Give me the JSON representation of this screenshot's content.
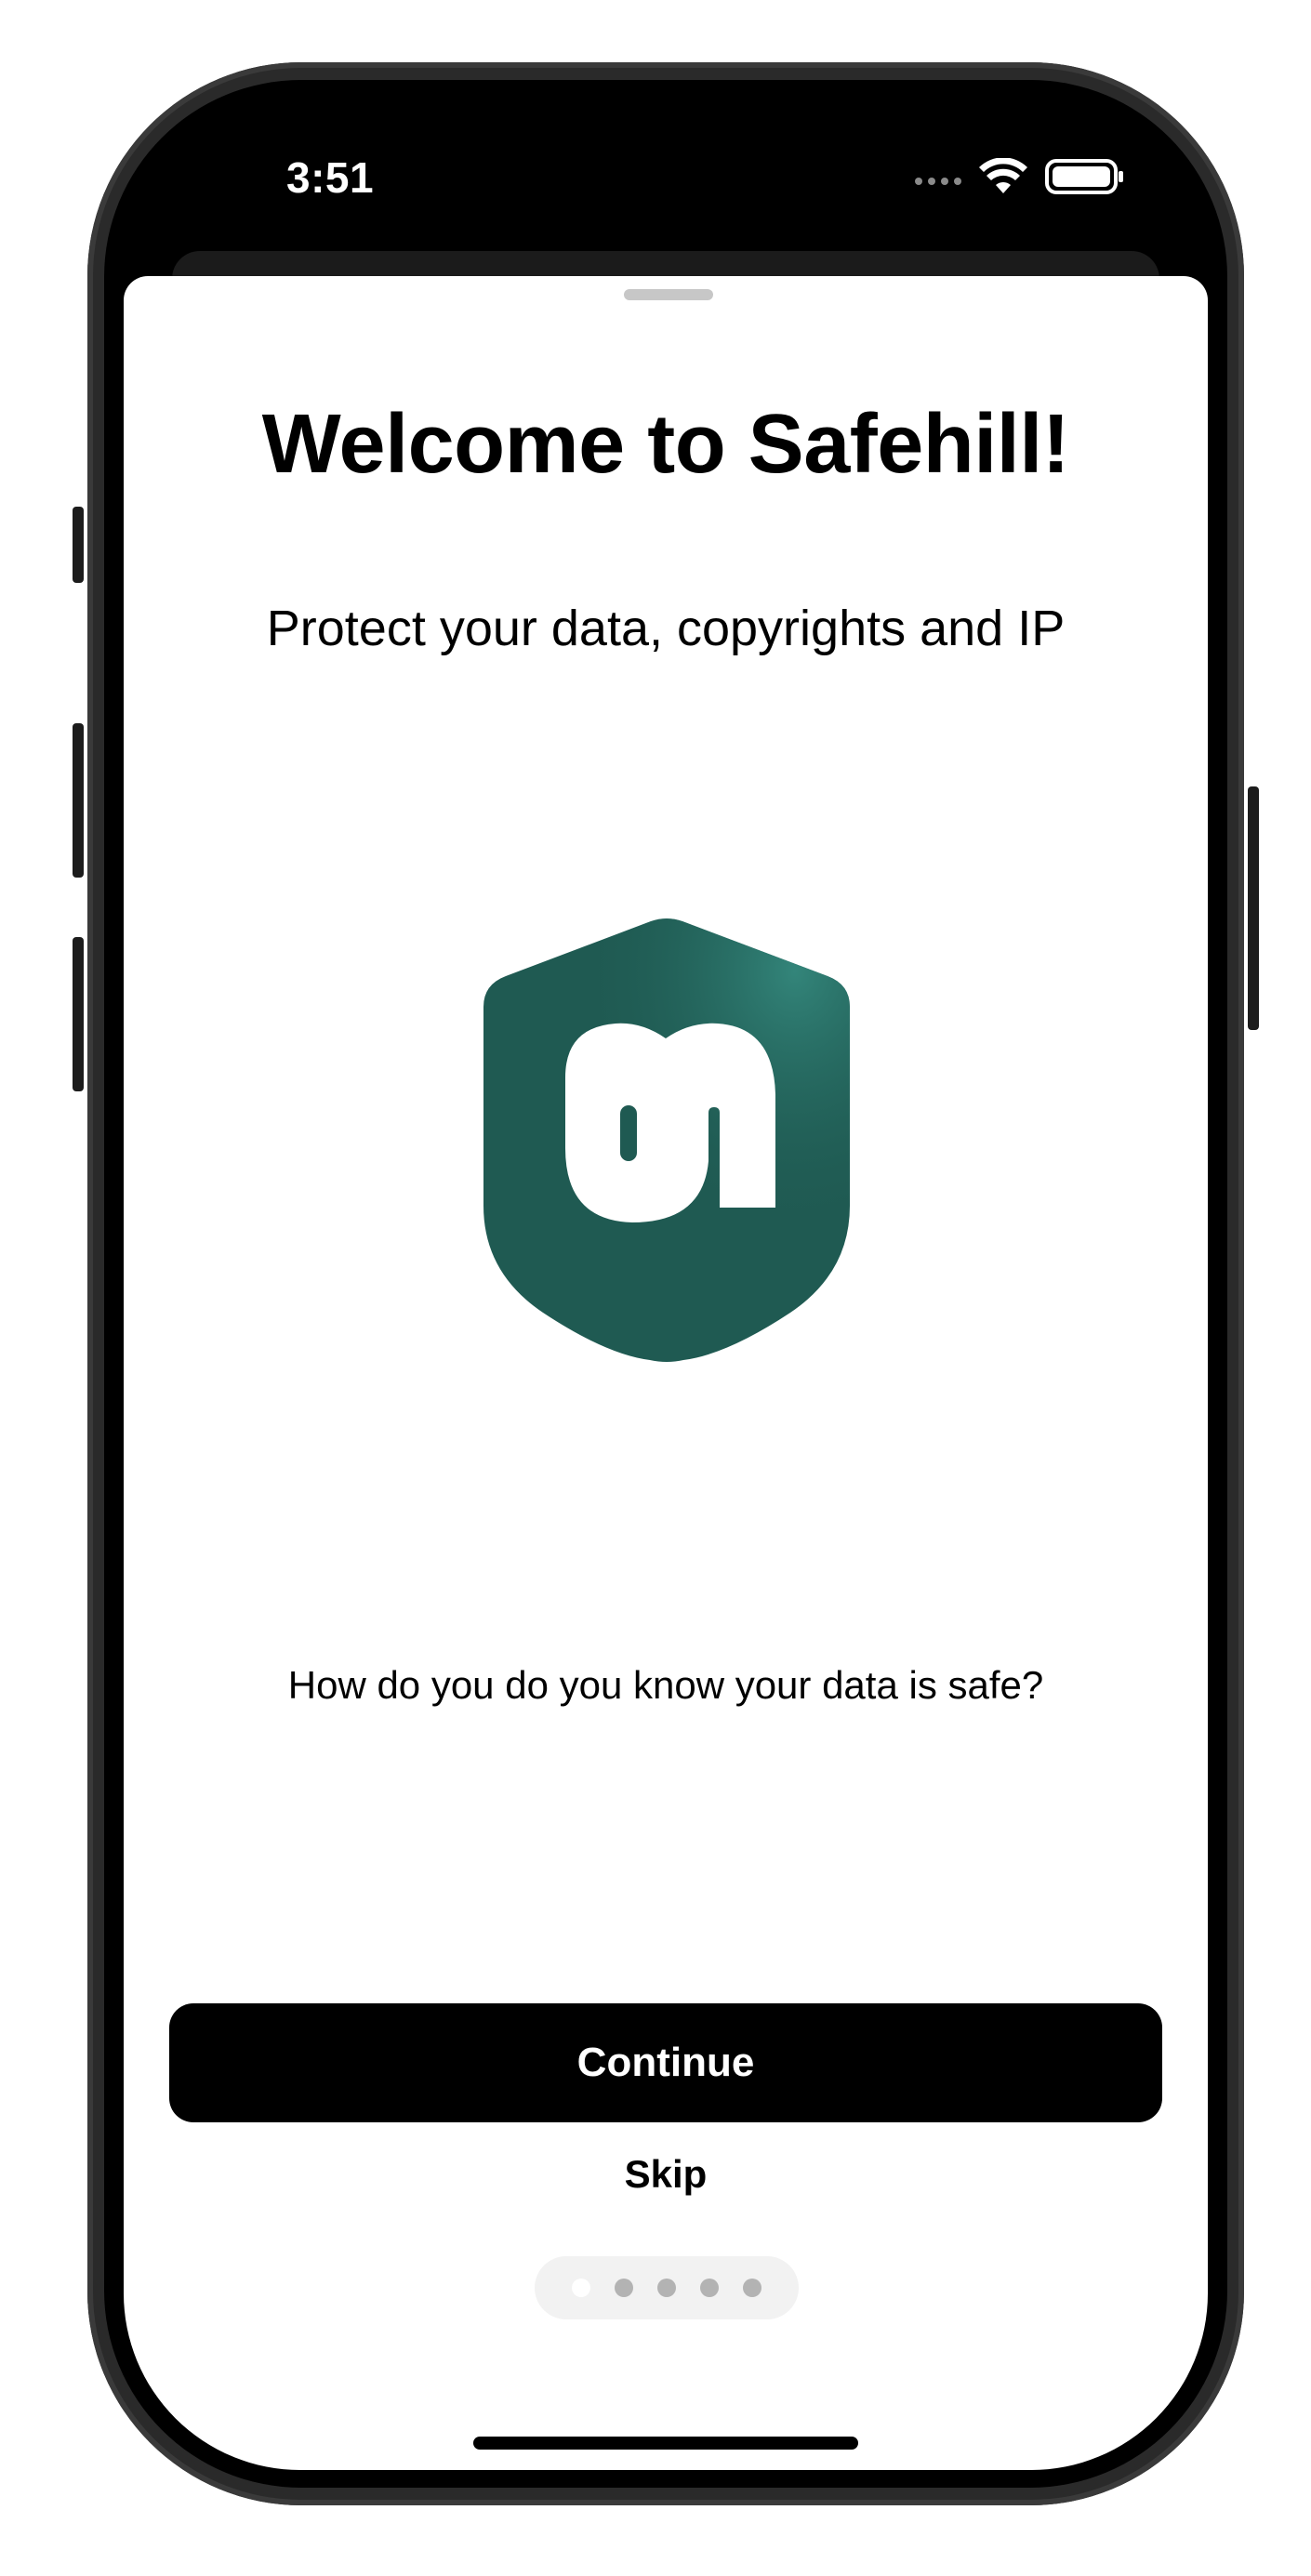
{
  "status_bar": {
    "time": "3:51",
    "wifi_icon": "wifi-icon",
    "battery_icon": "battery-icon"
  },
  "onboarding": {
    "title": "Welcome to Safehill!",
    "subtitle": "Protect your data, copyrights and IP",
    "question": "How do you do you know your data is safe?",
    "logo_icon": "safehill-shield-logo",
    "continue_label": "Continue",
    "skip_label": "Skip",
    "pagination": {
      "total_pages": 5,
      "current_page": 1
    }
  },
  "colors": {
    "brand_green_dark": "#1f5a52",
    "brand_green_light": "#2f7a70",
    "button_bg": "#000000",
    "button_text": "#ffffff"
  }
}
